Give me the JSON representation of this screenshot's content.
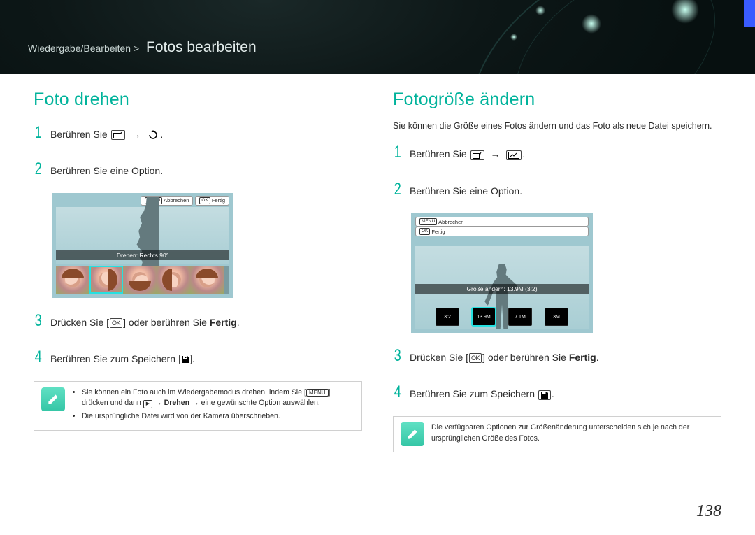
{
  "header": {
    "breadcrumb_path": "Wiedergabe/Bearbeiten >",
    "breadcrumb_title": "Fotos bearbeiten"
  },
  "left": {
    "heading": "Foto drehen",
    "steps": {
      "s1_a": "Berühren Sie",
      "s1_b": ".",
      "s2": "Berühren Sie eine Option.",
      "s3_a": "Drücken Sie [",
      "s3_b": "] oder berühren Sie ",
      "s3_bold": "Fertig",
      "s3_c": ".",
      "s4_a": "Berühren Sie zum Speichern",
      "s4_b": "."
    },
    "device": {
      "menu_label": "MENU",
      "cancel": "Abbrechen",
      "ok_label": "OK",
      "done": "Fertig",
      "caption": "Drehen: Rechts 90°"
    },
    "note": {
      "l1_a": "Sie können ein Foto auch im Wiedergabemodus drehen, indem Sie [",
      "l1_b": "] drücken und dann ",
      "l1_c": " → ",
      "l1_bold": "Drehen",
      "l1_d": " → eine gewünschte Option auswählen.",
      "l2": "Die ursprüngliche Datei wird von der Kamera überschrieben."
    }
  },
  "right": {
    "heading": "Fotogröße ändern",
    "intro": "Sie können die Größe eines Fotos ändern und das Foto als neue Datei speichern.",
    "steps": {
      "s1_a": "Berühren Sie",
      "s1_b": ".",
      "s2": "Berühren Sie eine Option.",
      "s3_a": "Drücken Sie [",
      "s3_b": "] oder berühren Sie ",
      "s3_bold": "Fertig",
      "s3_c": ".",
      "s4_a": "Berühren Sie zum Speichern",
      "s4_b": "."
    },
    "device": {
      "menu_label": "MENU",
      "cancel": "Abbrechen",
      "ok_label": "OK",
      "done": "Fertig",
      "caption": "Größe ändern: 13.9M (3:2)",
      "opts": [
        "3:2",
        "13.9M",
        "7.1M",
        "3M"
      ]
    },
    "note": {
      "text": "Die verfügbaren Optionen zur Größenänderung unterscheiden sich je nach der ursprünglichen Größe des Fotos."
    }
  },
  "icons": {
    "menu": "MENU",
    "ok_frame": "OK"
  },
  "page_number": "138"
}
